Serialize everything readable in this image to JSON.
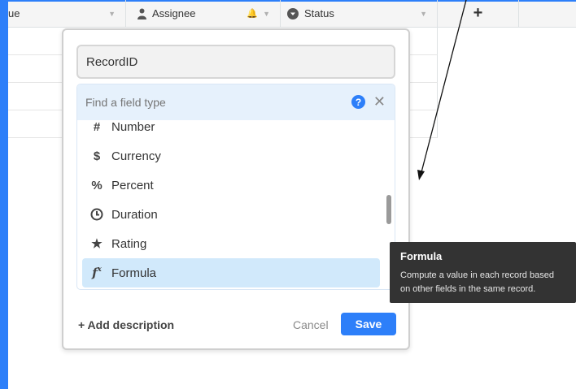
{
  "header": {
    "col_partial": "ue",
    "col_assignee": "Assignee",
    "col_status": "Status",
    "add_column": "+"
  },
  "dialog": {
    "field_name_value": "RecordID",
    "type_search_placeholder": "Find a field type",
    "field_types": [
      {
        "label": "Number",
        "icon": "hash-icon"
      },
      {
        "label": "Currency",
        "icon": "dollar-icon"
      },
      {
        "label": "Percent",
        "icon": "percent-icon"
      },
      {
        "label": "Duration",
        "icon": "clock-icon"
      },
      {
        "label": "Rating",
        "icon": "star-icon"
      },
      {
        "label": "Formula",
        "icon": "function-icon"
      }
    ],
    "selected_type": "Formula",
    "add_description": "+ Add description",
    "cancel_label": "Cancel",
    "save_label": "Save"
  },
  "tooltip": {
    "title": "Formula",
    "body": "Compute a value in each record based on other fields in the same record."
  },
  "colors": {
    "accent": "#2d7ff9",
    "selected_bg": "#d1e9fb",
    "search_bg": "#e6f1fc",
    "tooltip_bg": "#333333"
  }
}
